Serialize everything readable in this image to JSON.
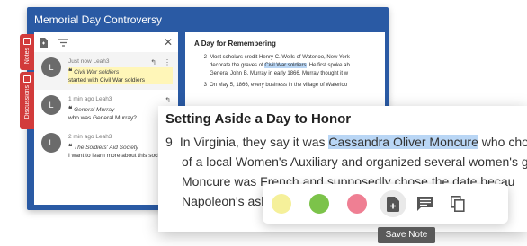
{
  "window": {
    "title": "Memorial Day Controversy"
  },
  "tabs": {
    "notes": "Notes",
    "discussions": "Discussions"
  },
  "notes": [
    {
      "initial": "L",
      "meta": "Just now Leah3",
      "quote": "Civil War soldiers",
      "text": "started with Civil War soldiers"
    },
    {
      "initial": "L",
      "meta": "1 min ago Leah3",
      "quote": "General Murray",
      "text": "who was General Murray?"
    },
    {
      "initial": "L",
      "meta": "2 min ago Leah3",
      "quote": "The Soldiers' Aid Society",
      "text": "I want to learn more about this society"
    }
  ],
  "document": {
    "heading": "A Day for Remembering",
    "p2": {
      "num": "2",
      "a": "Most scholars credit Henry C. Wells of Waterloo, New York",
      "b1": "decorate the graves of ",
      "sel": "Civil War soldiers",
      "b2": ". He first spoke ab",
      "c": "General John B. Murray in early 1866. Murray thought it w"
    },
    "p3": {
      "num": "3",
      "a": "On May 5, 1866, every business in the village of Waterloo"
    }
  },
  "zoom": {
    "heading": "Setting Aside a Day to Honor",
    "num": "9",
    "l1a": "In Virginia, they say it was ",
    "l1sel": "Cassandra Oliver Moncure",
    "l1b": " who chose",
    "l2": "of a local Women's Auxiliary and organized several women's g",
    "l3": "Moncure was French and supposedly chose the date becau",
    "l4": "Napoleon's ashe"
  },
  "toolbar": {
    "colors": [
      "#f5f09a",
      "#7cc34a",
      "#ef7f93"
    ],
    "tooltip": "Save Note"
  }
}
